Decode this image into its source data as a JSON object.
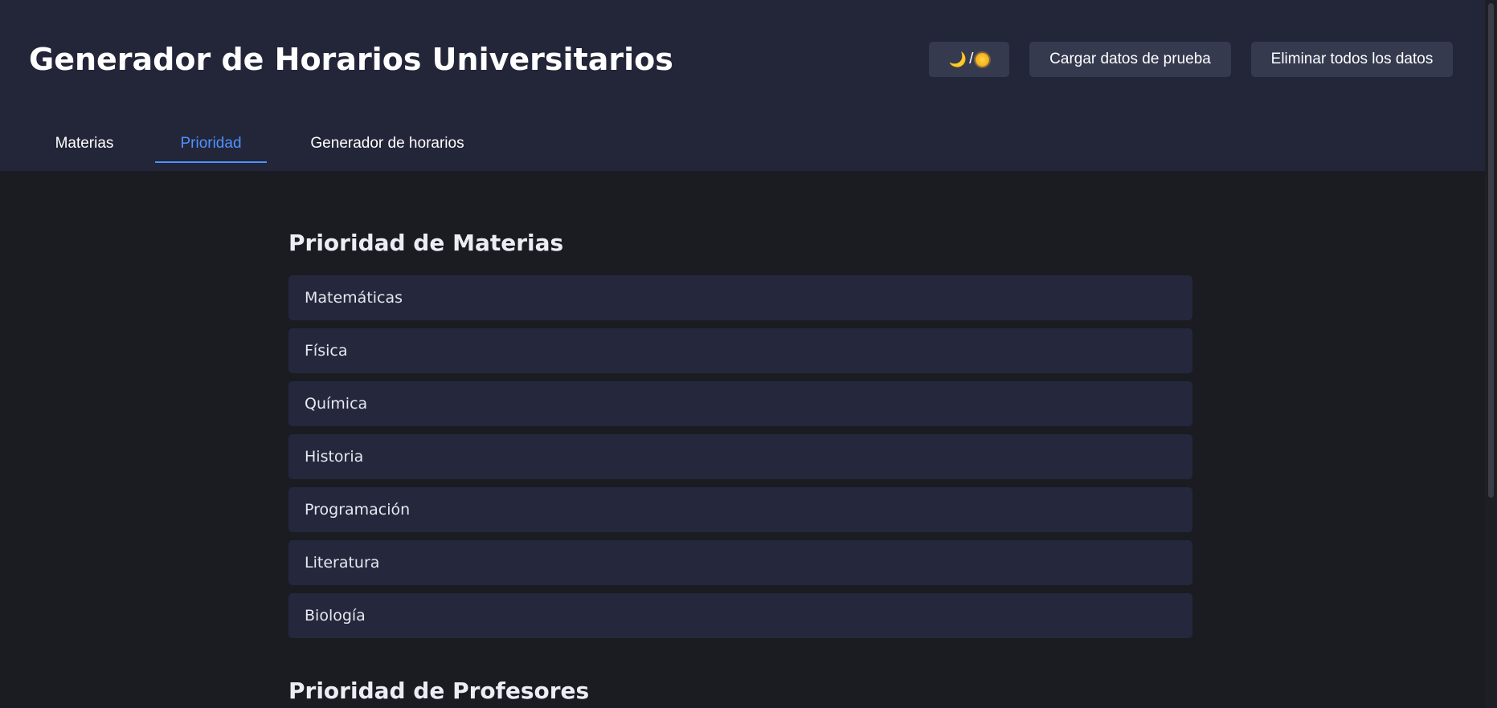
{
  "header": {
    "title": "Generador de Horarios Universitarios",
    "theme_toggle": {
      "moon": "🌙",
      "separator": "/",
      "sun_icon": "sun-icon"
    },
    "load_button": "Cargar datos de prueba",
    "clear_button": "Eliminar todos los datos"
  },
  "tabs": [
    {
      "label": "Materias",
      "active": false
    },
    {
      "label": "Prioridad",
      "active": true
    },
    {
      "label": "Generador de horarios",
      "active": false
    }
  ],
  "main": {
    "subjects_title": "Prioridad de Materias",
    "subjects": [
      "Matemáticas",
      "Física",
      "Química",
      "Historia",
      "Programación",
      "Literatura",
      "Biología"
    ],
    "teachers_title": "Prioridad de Profesores"
  },
  "colors": {
    "page_bg": "#1b1c22",
    "header_bg": "#232539",
    "button_bg": "#353a4f",
    "item_bg": "#25273d",
    "accent": "#4f93ff"
  }
}
